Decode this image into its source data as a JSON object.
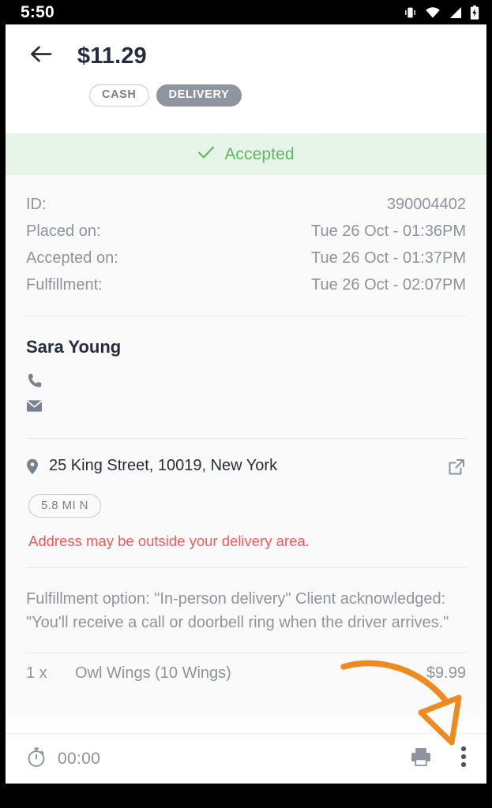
{
  "status_bar": {
    "time": "5:50",
    "icons": [
      "vibrate-icon",
      "wifi-icon",
      "cellular-signal-icon",
      "battery-charging-icon"
    ]
  },
  "header": {
    "back_icon": "back-arrow-icon",
    "title": "$11.29",
    "tags": [
      {
        "label": "CASH",
        "style": "outline"
      },
      {
        "label": "DELIVERY",
        "style": "solid"
      }
    ]
  },
  "status_banner": {
    "icon": "check-icon",
    "label": "Accepted",
    "text_color": "#5cb85c",
    "background_color": "#e7f4e8"
  },
  "order_meta": {
    "rows": [
      {
        "label": "ID:",
        "value": "390004402"
      },
      {
        "label": "Placed on:",
        "value": "Tue 26 Oct - 01:36PM"
      },
      {
        "label": "Accepted on:",
        "value": "Tue 26 Oct - 01:37PM"
      },
      {
        "label": "Fulfillment:",
        "value": "Tue 26 Oct - 02:07PM"
      }
    ]
  },
  "customer": {
    "name": "Sara Young",
    "phone_icon": "phone-icon",
    "email_icon": "email-icon"
  },
  "address": {
    "pin_icon": "location-pin-icon",
    "text": "25 King Street, 10019, New York",
    "open_external_icon": "external-link-icon",
    "distance_badge": "5.8 MI N",
    "warning": "Address may be outside your delivery area.",
    "warning_color": "#f25a5a"
  },
  "fulfillment_note": {
    "text": "Fulfillment option: \"In-person delivery\" Client acknowledged: \"You'll receive a call or doorbell ring when the driver arrives.\""
  },
  "items": [
    {
      "qty": "1 x",
      "name": "Owl Wings (10 Wings)",
      "price": "$9.99"
    }
  ],
  "bottom_bar": {
    "timer_icon": "stopwatch-icon",
    "timer": "00:00",
    "print_icon": "printer-icon",
    "more_icon": "more-vertical-icon"
  },
  "annotation": {
    "color": "#ef8a21",
    "shape": "curved-arrow-pointing-to-more-menu"
  }
}
